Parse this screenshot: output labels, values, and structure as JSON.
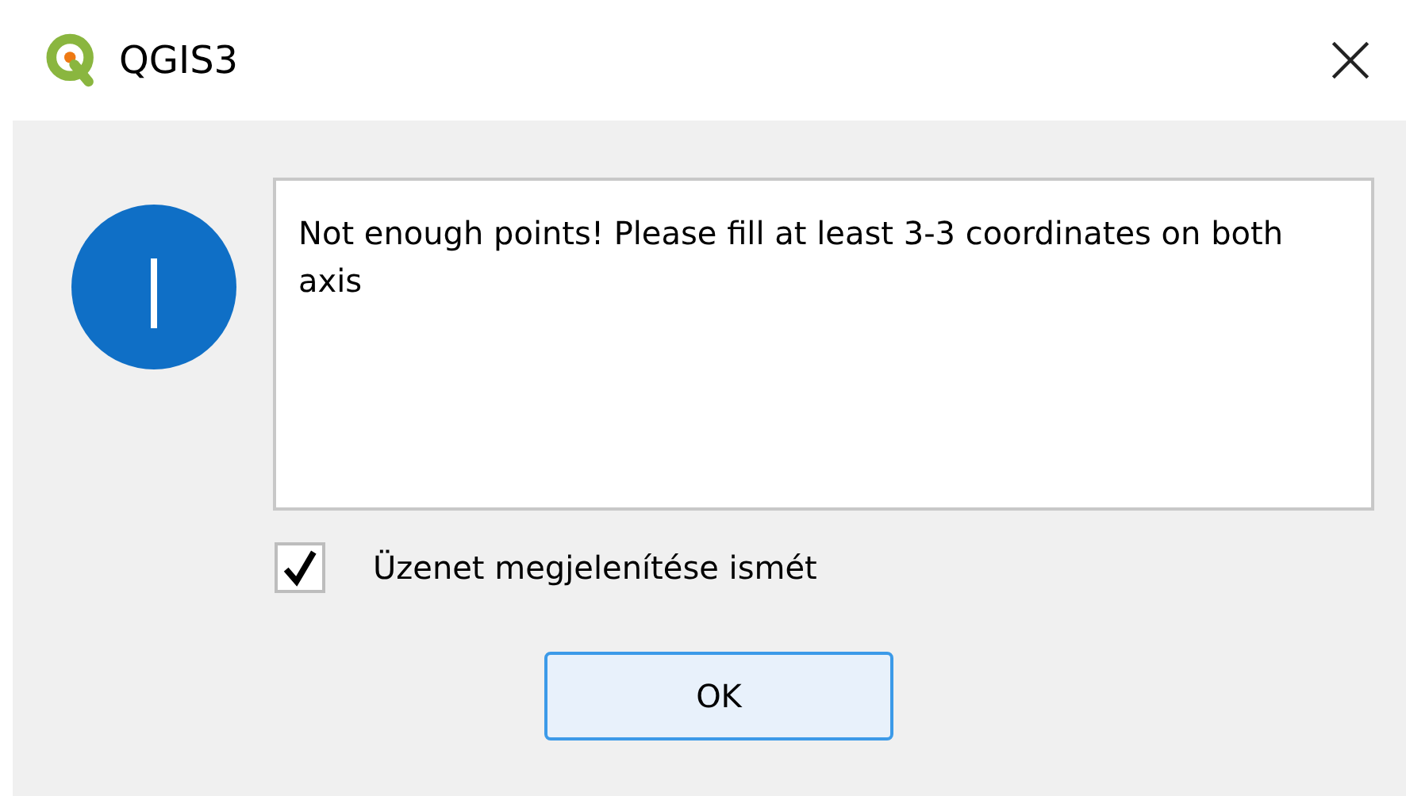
{
  "window": {
    "title": "QGIS3"
  },
  "message": {
    "text": "Not enough points! Please fill at least 3-3 coordinates on both axis"
  },
  "checkbox": {
    "label": "Üzenet megjelenítése ismét",
    "checked": true
  },
  "buttons": [
    {
      "label": "OK"
    }
  ]
}
